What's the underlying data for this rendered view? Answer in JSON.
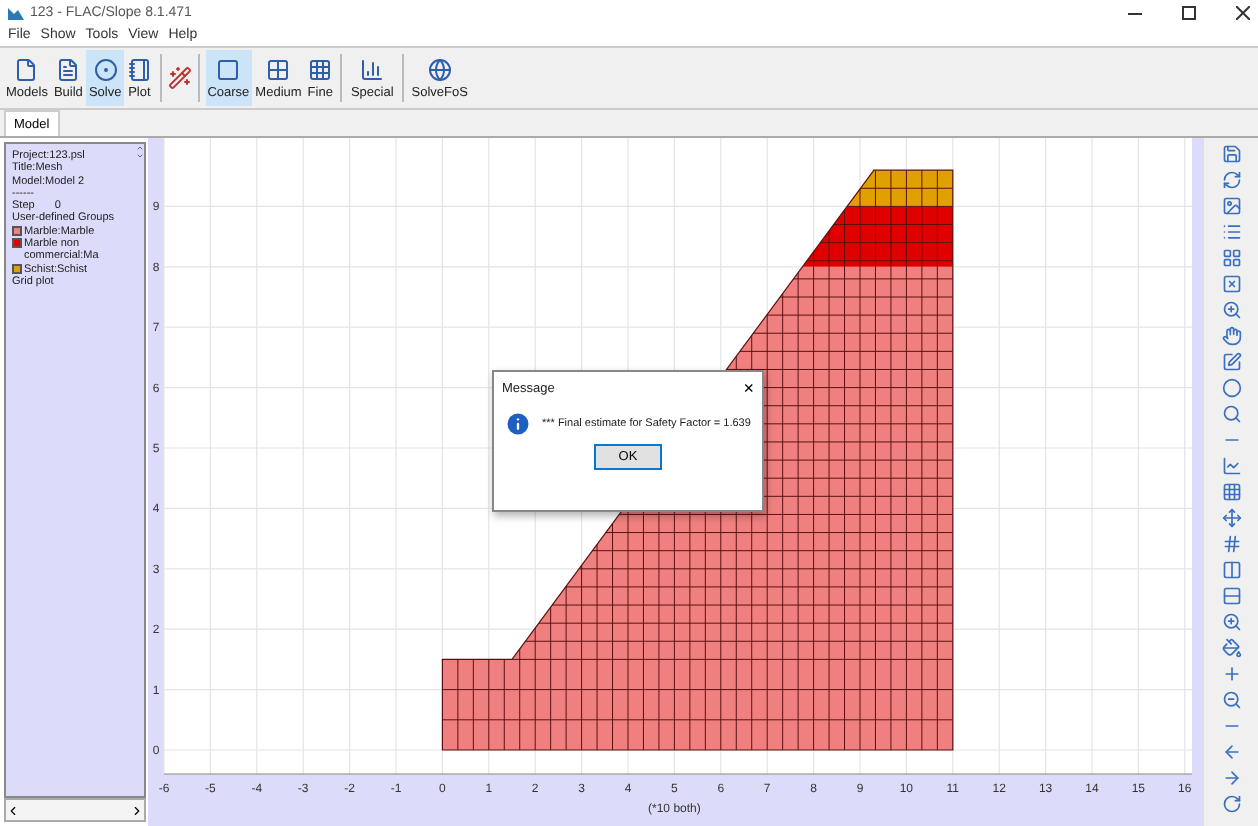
{
  "window": {
    "title": "123 - FLAC/Slope 8.1.471"
  },
  "menu": [
    "File",
    "Show",
    "Tools",
    "View",
    "Help"
  ],
  "toolbar": [
    {
      "label": "Models",
      "selected": false
    },
    {
      "label": "Build",
      "selected": false
    },
    {
      "label": "Solve",
      "selected": true
    },
    {
      "label": "Plot",
      "selected": false
    },
    {
      "label": "Coarse",
      "selected": true
    },
    {
      "label": "Medium",
      "selected": false
    },
    {
      "label": "Fine",
      "selected": false
    },
    {
      "label": "Special",
      "selected": false
    },
    {
      "label": "SolveFoS",
      "selected": false
    }
  ],
  "tabs": [
    {
      "label": "Model",
      "selected": true
    }
  ],
  "info_panel": {
    "lines": [
      "Project:123.psl",
      "Title:Mesh",
      "Model:Model 2",
      "------"
    ],
    "step": {
      "label": "Step",
      "value": "0"
    },
    "groups_heading": "User-defined Groups",
    "groups": [
      {
        "name": "Marble:Marble",
        "color": "#f08080"
      },
      {
        "name": "Marble non commercial:Ma",
        "color": "#e00000"
      },
      {
        "name": "Schist:Schist",
        "color": "#e0a000"
      }
    ],
    "footer": "Grid plot"
  },
  "plot": {
    "x_ticks": [
      "-6",
      "-5",
      "-4",
      "-3",
      "-2",
      "-1",
      "0",
      "1",
      "2",
      "3",
      "4",
      "5",
      "6",
      "7",
      "8",
      "9",
      "10",
      "11",
      "12",
      "13",
      "14",
      "15",
      "16"
    ],
    "y_ticks": [
      "9",
      "8",
      "7",
      "6",
      "5",
      "4",
      "3",
      "2",
      "1",
      "0"
    ],
    "x_label": "(*10 both)"
  },
  "dialog": {
    "title": "Message",
    "close": "×",
    "message": "*** Final estimate for Safety Factor = 1.639",
    "button": "OK"
  }
}
